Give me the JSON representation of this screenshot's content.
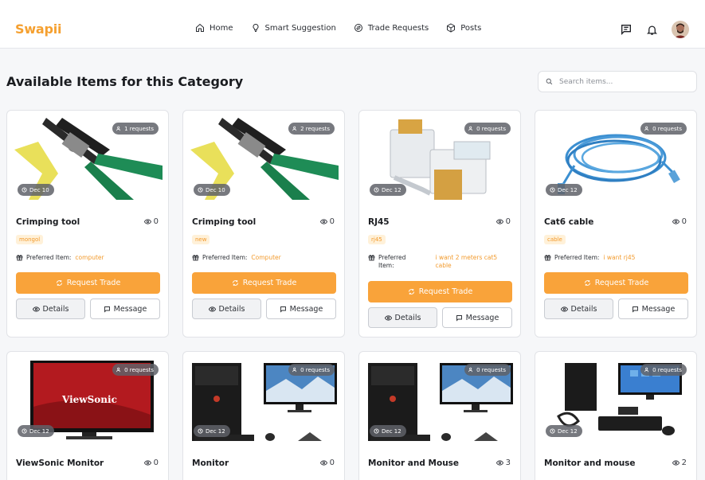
{
  "app": {
    "logo": "Swapii"
  },
  "nav": {
    "items": [
      {
        "label": "Home",
        "icon": "home-icon"
      },
      {
        "label": "Smart Suggestion",
        "icon": "lightbulb-icon"
      },
      {
        "label": "Trade Requests",
        "icon": "swap-icon"
      },
      {
        "label": "Posts",
        "icon": "box-icon"
      }
    ],
    "right_icons": [
      "message-icon",
      "bell-icon",
      "user-avatar"
    ]
  },
  "page": {
    "title": "Available Items for this Category",
    "search_placeholder": "Search items..."
  },
  "colors": {
    "accent": "#f9a33a",
    "logo": "#f5a030",
    "tag_bg": "#fff1d9",
    "tag_text": "#f3992b"
  },
  "cards": [
    {
      "requests": "1 requests",
      "date": "Dec 10",
      "title": "Crimping tool",
      "views": "0",
      "tag": "mongol",
      "pref_label": "Preferred Item:",
      "pref_value": "computer",
      "trade": "Request Trade",
      "details": "Details",
      "message": "Message",
      "image": "crimping-tool"
    },
    {
      "requests": "2 requests",
      "date": "Dec 10",
      "title": "Crimping tool",
      "views": "0",
      "tag": "new",
      "pref_label": "Preferred Item:",
      "pref_value": "Computer",
      "trade": "Request Trade",
      "details": "Details",
      "message": "Message",
      "image": "crimping-tool"
    },
    {
      "requests": "0 requests",
      "date": "Dec 12",
      "title": "RJ45",
      "views": "0",
      "tag": "rj45",
      "pref_label": "Preferred Item:",
      "pref_value": "i want 2 meters cat5 cable",
      "trade": "Request Trade",
      "details": "Details",
      "message": "Message",
      "image": "rj45-connectors"
    },
    {
      "requests": "0 requests",
      "date": "Dec 12",
      "title": "Cat6 cable",
      "views": "0",
      "tag": "cable",
      "pref_label": "Preferred Item:",
      "pref_value": "i want rj45",
      "trade": "Request Trade",
      "details": "Details",
      "message": "Message",
      "image": "blue-cable"
    },
    {
      "requests": "0 requests",
      "date": "Dec 12",
      "title": "ViewSonic Monitor",
      "views": "0",
      "image": "viewsonic-monitor",
      "brand_text": "ViewSonic"
    },
    {
      "requests": "0 requests",
      "date": "Dec 12",
      "title": "Monitor",
      "views": "0",
      "image": "pc-set"
    },
    {
      "requests": "0 requests",
      "date": "Dec 12",
      "title": "Monitor and Mouse",
      "views": "3",
      "image": "pc-set"
    },
    {
      "requests": "0 requests",
      "date": "Dec 12",
      "title": "Monitor and mouse",
      "views": "2",
      "image": "pc-set-2"
    }
  ]
}
